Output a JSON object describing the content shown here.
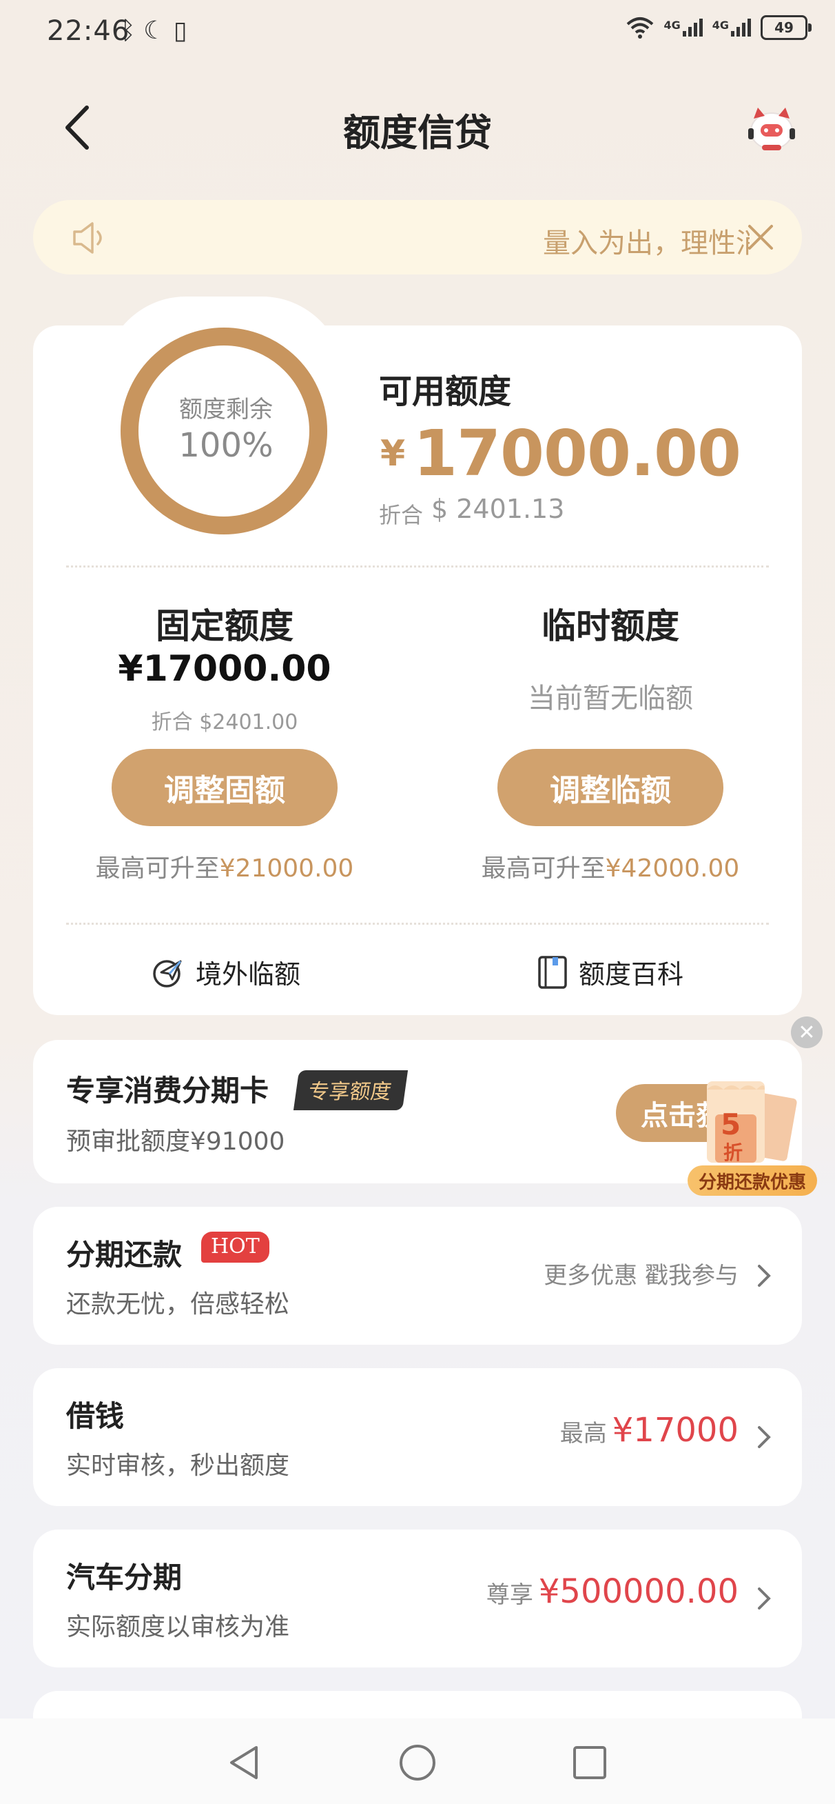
{
  "status_bar": {
    "time": "22:46",
    "signal_1": "4G",
    "signal_2": "4G",
    "battery": "49"
  },
  "header": {
    "title": "额度信贷"
  },
  "notice": {
    "text": "量入为出，理性消费"
  },
  "quota": {
    "ring_label": "额度剩余",
    "ring_value": "100%",
    "remaining_fraction": 1.0,
    "available_label": "可用额度",
    "available_currency": "¥",
    "available_amount": "17000.00",
    "conversion_label": "折合",
    "conversion_value": "$ 2401.13",
    "fixed": {
      "title": "固定额度",
      "amount": "¥17000.00",
      "conversion": "折合 $2401.00",
      "button": "调整固额",
      "max_prefix": "最高可升至",
      "max_value": "¥21000.00"
    },
    "temporary": {
      "title": "临时额度",
      "none_text": "当前暂无临额",
      "button": "调整临额",
      "max_prefix": "最高可升至",
      "max_value": "¥42000.00"
    },
    "links": {
      "overseas": "境外临额",
      "wiki": "额度百科"
    }
  },
  "installment_card": {
    "title": "专享消费分期卡",
    "badge": "专享额度",
    "subtitle": "预审批额度¥91000",
    "button": "点击获取",
    "promo_badge": "分期还款优惠",
    "promo_discount_num": "5",
    "promo_discount_unit": "折"
  },
  "list": [
    {
      "title": "分期还款",
      "tag": "HOT",
      "subtitle": "还款无忧，倍感轻松",
      "right_label": "更多优惠 戳我参与",
      "right_value": ""
    },
    {
      "title": "借钱",
      "tag": "",
      "subtitle": "实时审核，秒出额度",
      "right_label": "最高",
      "right_value": "¥17000"
    },
    {
      "title": "汽车分期",
      "tag": "",
      "subtitle": "实际额度以审核为准",
      "right_label": "尊享",
      "right_value": "¥500000.00"
    }
  ],
  "colors": {
    "gold": "#c8955e",
    "button_gold": "#d1a26e",
    "red": "#e0454b",
    "notice_bg": "#fdf6e4"
  }
}
